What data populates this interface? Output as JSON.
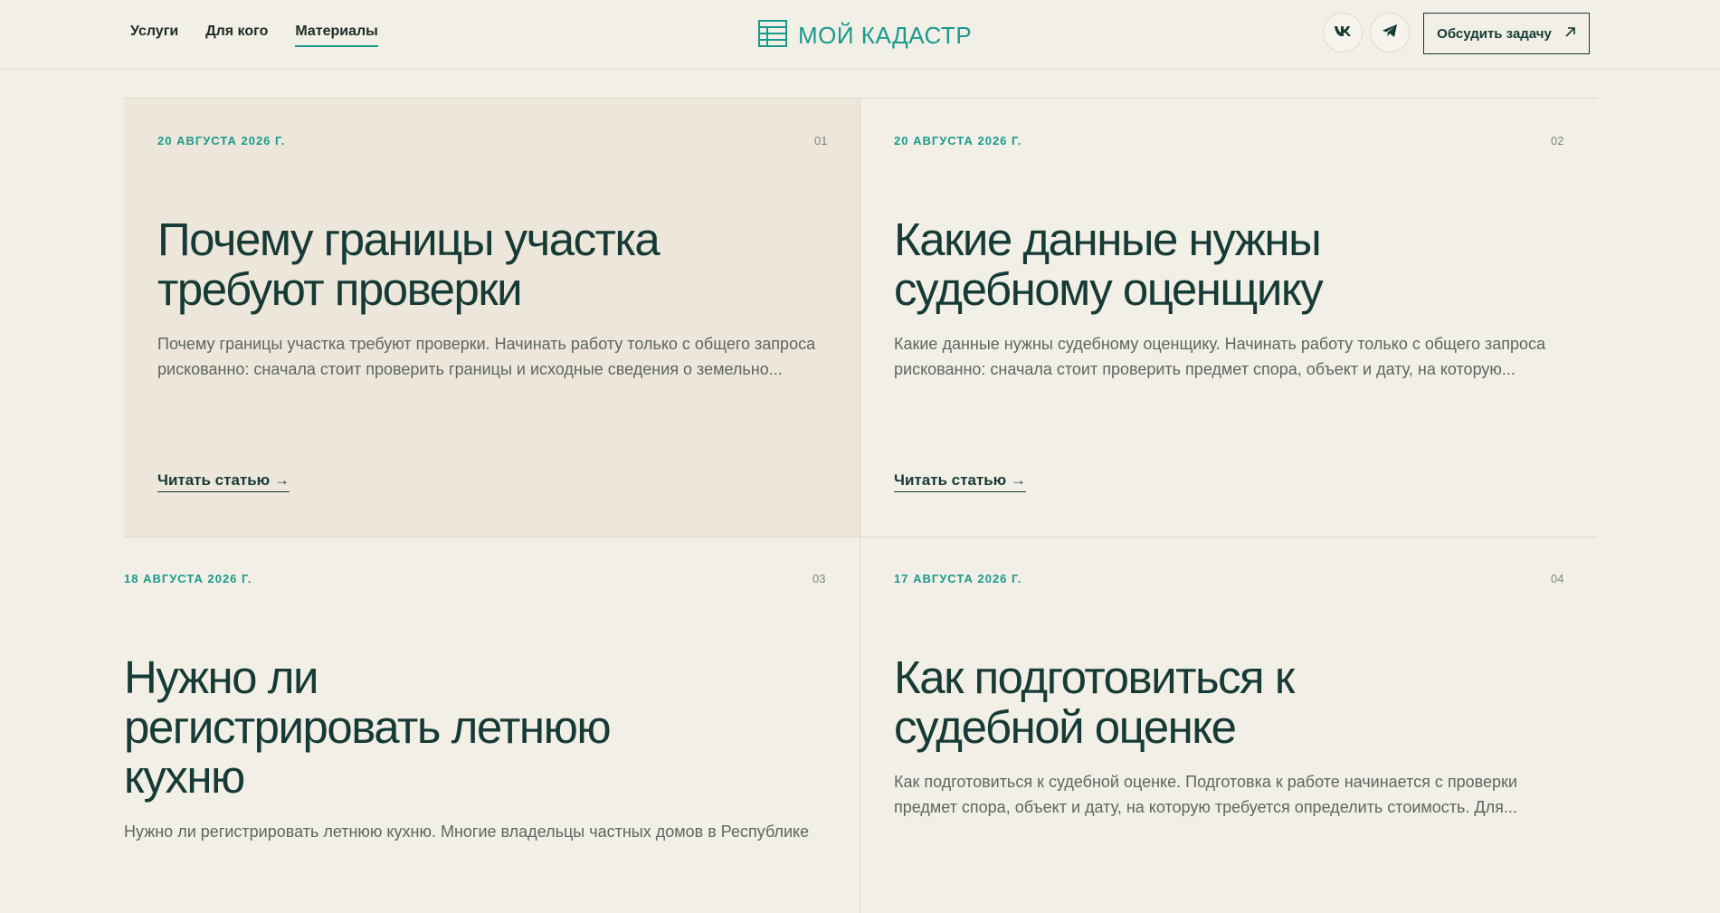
{
  "nav": {
    "items": [
      {
        "label": "Услуги"
      },
      {
        "label": "Для кого"
      },
      {
        "label": "Материалы"
      }
    ]
  },
  "logo": {
    "text": "МОЙ КАДАСТР"
  },
  "social": {
    "vk_icon": "vk-icon",
    "telegram_icon": "telegram-icon"
  },
  "cta": {
    "label": "Обсудить задачу",
    "icon": "arrow-up-right-icon"
  },
  "colors": {
    "accent": "#1a9a8c",
    "text": "#163a35",
    "background": "#f2efe6",
    "highlight": "#ede6da"
  },
  "articles": [
    {
      "date": "20 АВГУСТА 2026 Г.",
      "num": "01",
      "title_line1": "Почему границы участка",
      "title_line2": "требуют проверки",
      "excerpt_line1": "Почему границы участка требуют проверки. Начинать работу только с общего запроса",
      "excerpt_line2": "рискованно: сначала стоит проверить границы и исходные сведения о земельно...",
      "read_more": "Читать статью →"
    },
    {
      "date": "20 АВГУСТА 2026 Г.",
      "num": "02",
      "title_line1": "Какие данные нужны",
      "title_line2": "судебному оценщику",
      "excerpt_line1": "Какие данные нужны судебному оценщику. Начинать работу только с общего запроса",
      "excerpt_line2": "рискованно: сначала стоит проверить предмет спора, объект и дату, на которую...",
      "read_more": "Читать статью →"
    },
    {
      "date": "18 АВГУСТА 2026 Г.",
      "num": "03",
      "title_line1": "Нужно ли",
      "title_line2": "регистрировать летнюю",
      "title_line3": "кухню",
      "excerpt_line1": "Нужно ли регистрировать летнюю кухню. Многие владельцы частных домов в Республике"
    },
    {
      "date": "17 АВГУСТА 2026 Г.",
      "num": "04",
      "title_line1": "Как подготовиться к",
      "title_line2": "судебной оценке",
      "excerpt_line1": "Как подготовиться к судебной оценке. Подготовка к работе начинается с проверки",
      "excerpt_line2": "предмет спора, объект и дату, на которую требуется определить стоимость. Для..."
    }
  ]
}
